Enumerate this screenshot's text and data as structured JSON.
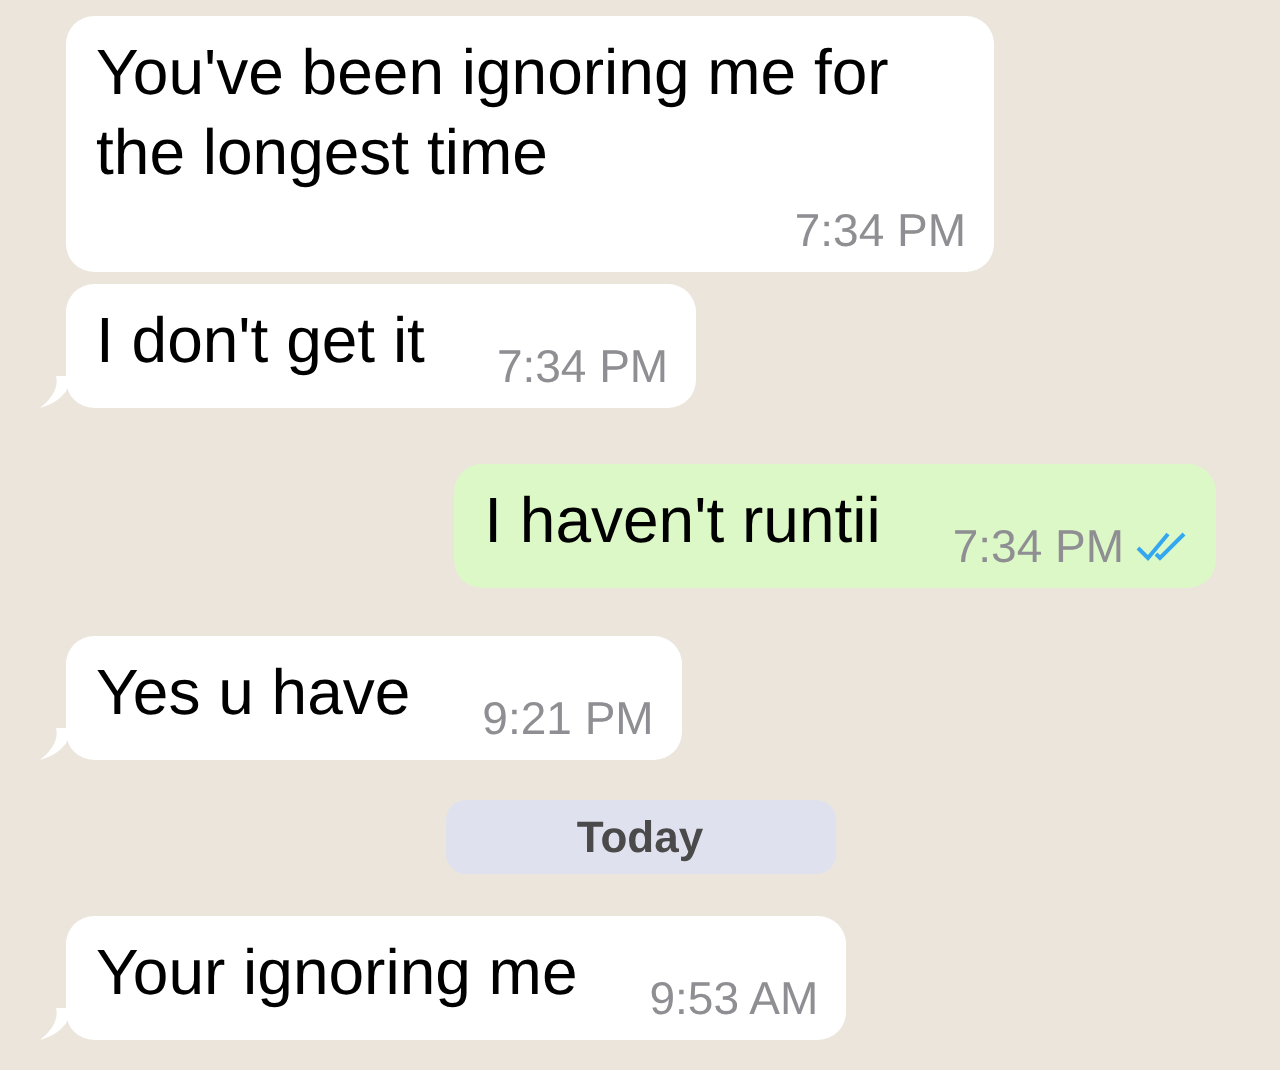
{
  "messages": [
    {
      "kind": "message",
      "outgoing": false,
      "text": "You've been ignoring me for the longest time",
      "time": "7:34 PM",
      "tail": false
    },
    {
      "kind": "message",
      "outgoing": false,
      "text": "I don't get it",
      "time": "7:34 PM",
      "tail": true
    },
    {
      "kind": "message",
      "outgoing": true,
      "text": "I haven't runtii",
      "time": "7:34 PM",
      "tail": false,
      "read": true
    },
    {
      "kind": "message",
      "outgoing": false,
      "text": "Yes u have",
      "time": "9:21 PM",
      "tail": true
    },
    {
      "kind": "date",
      "text": "Today"
    },
    {
      "kind": "message",
      "outgoing": false,
      "text": "Your ignoring me",
      "time": "9:53 AM",
      "tail": true
    }
  ]
}
